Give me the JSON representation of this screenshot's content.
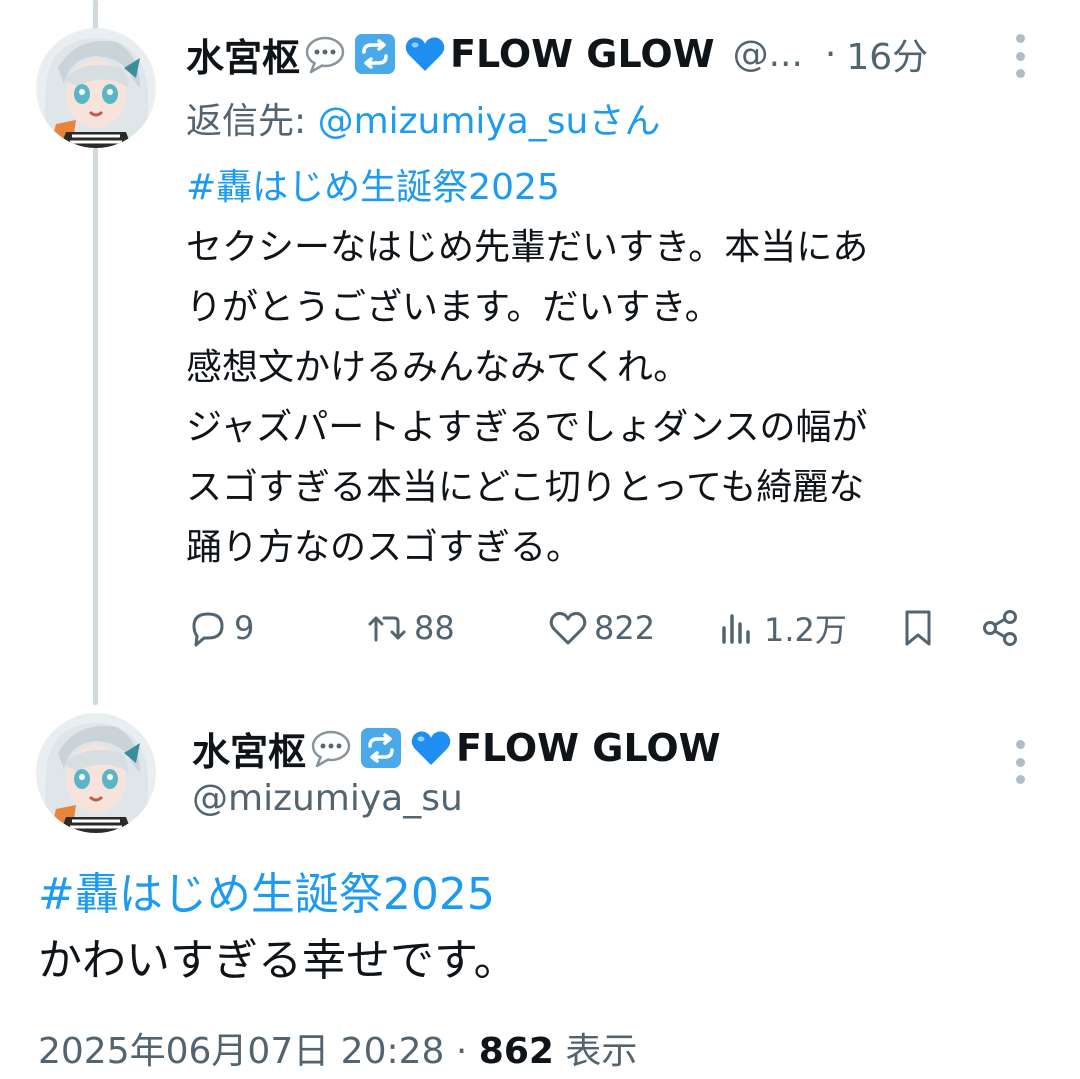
{
  "reply_tweet": {
    "display_name": "水宮枢",
    "name_emojis": [
      "speech-bubble-icon",
      "repeat-icon",
      "blue-heart-icon"
    ],
    "name_suffix": "FLOW GLOW",
    "handle_truncated": "@...",
    "dot": "·",
    "time": "16分",
    "reply_to_label": "返信先: ",
    "reply_to_mention": "@mizumiya_suさん",
    "hashtag": "#轟はじめ生誕祭2025",
    "body_lines": [
      "セクシーなはじめ先輩だいすき。本当にあ",
      "りがとうございます。だいすき。",
      "感想文かけるみんなみてくれ。",
      "ジャズパートよすぎるでしょダンスの幅が",
      "スゴすぎる本当にどこ切りとっても綺麗な",
      "踊り方なのスゴすぎる。"
    ],
    "actions": {
      "replies": "9",
      "reposts": "88",
      "likes": "822",
      "views": "1.2万"
    }
  },
  "main_tweet": {
    "display_name": "水宮枢",
    "name_suffix": "FLOW GLOW",
    "handle": "@mizumiya_su",
    "hashtag": "#轟はじめ生誕祭2025",
    "body": "かわいすぎる幸せです。",
    "timestamp": "2025年06月07日 20:28",
    "dot": " · ",
    "view_count": "862",
    "view_label": " 表示"
  },
  "colors": {
    "link_blue": "#1d9bf0",
    "secondary_text": "#536471",
    "primary_text": "#0f1419",
    "thread_line": "#cfd9de"
  }
}
